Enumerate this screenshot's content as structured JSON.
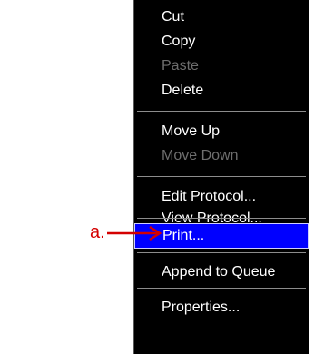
{
  "menu": {
    "items": [
      {
        "label": "Cut",
        "enabled": true
      },
      {
        "label": "Copy",
        "enabled": true
      },
      {
        "label": "Paste",
        "enabled": false
      },
      {
        "label": "Delete",
        "enabled": true
      },
      {
        "label": "Move Up",
        "enabled": true
      },
      {
        "label": "Move Down",
        "enabled": false
      },
      {
        "label": "Edit Protocol...",
        "enabled": true
      },
      {
        "label": "View Protocol...",
        "enabled": true
      },
      {
        "label": "Print...",
        "enabled": true,
        "highlighted": true
      },
      {
        "label": "Append to Queue",
        "enabled": true
      },
      {
        "label": "Properties...",
        "enabled": true
      }
    ]
  },
  "annotation": {
    "label": "a.",
    "color": "#d40000"
  },
  "colors": {
    "menu_background": "#000000",
    "highlight": "#0000ff",
    "text": "#ffffff",
    "disabled_text": "#6e6e6e"
  }
}
